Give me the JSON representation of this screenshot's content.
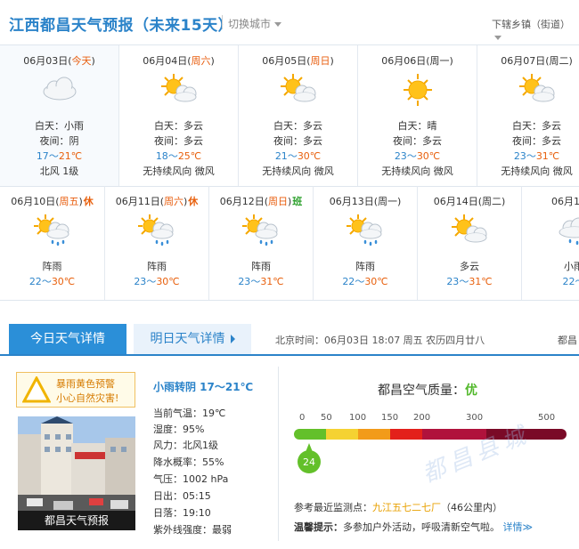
{
  "header": {
    "title": "江西都昌天气预报（未来15天）",
    "switch_city": "切换城市",
    "sub_area": "下辖乡镇（街道）"
  },
  "row1": [
    {
      "date": "06月03日",
      "weekday": "今天",
      "weekday_colored": true,
      "icon": "cloud-rain-icon",
      "day": "白天：小雨",
      "night": "夜间：阴",
      "lo": "17",
      "hi": "21℃",
      "wind": "北风 1级"
    },
    {
      "date": "06月04日",
      "weekday": "周六",
      "weekday_colored": true,
      "icon": "sun-cloud-icon",
      "day": "白天：多云",
      "night": "夜间：多云",
      "lo": "18",
      "hi": "25℃",
      "wind": "无持续风向 微风"
    },
    {
      "date": "06月05日",
      "weekday": "周日",
      "weekday_colored": true,
      "icon": "sun-cloud-icon",
      "day": "白天：多云",
      "night": "夜间：多云",
      "lo": "21",
      "hi": "30℃",
      "wind": "无持续风向 微风"
    },
    {
      "date": "06月06日",
      "weekday": "周一",
      "weekday_colored": false,
      "icon": "sun-icon",
      "day": "白天：晴",
      "night": "夜间：多云",
      "lo": "23",
      "hi": "30℃",
      "wind": "无持续风向 微风"
    },
    {
      "date": "06月07日",
      "weekday": "周二",
      "weekday_colored": false,
      "icon": "sun-cloud-icon",
      "day": "白天：多云",
      "night": "夜间：多云",
      "lo": "23",
      "hi": "31℃",
      "wind": "无持续风向 微风"
    }
  ],
  "row2": [
    {
      "date": "06月10日",
      "weekday": "周五",
      "weekday_colored": true,
      "tag": "休",
      "tag_type": "xiu",
      "icon": "sun-rain-icon",
      "desc": "阵雨",
      "lo": "22",
      "hi": "30℃"
    },
    {
      "date": "06月11日",
      "weekday": "周六",
      "weekday_colored": true,
      "tag": "休",
      "tag_type": "xiu",
      "icon": "sun-rain-icon",
      "desc": "阵雨",
      "lo": "23",
      "hi": "30℃"
    },
    {
      "date": "06月12日",
      "weekday": "周日",
      "weekday_colored": true,
      "tag": "班",
      "tag_type": "ban",
      "icon": "sun-rain-icon",
      "desc": "阵雨",
      "lo": "23",
      "hi": "31℃"
    },
    {
      "date": "06月13日",
      "weekday": "周一",
      "weekday_colored": false,
      "tag": "",
      "tag_type": "",
      "icon": "sun-rain-icon",
      "desc": "阵雨",
      "lo": "22",
      "hi": "30℃"
    },
    {
      "date": "06月14日",
      "weekday": "周二",
      "weekday_colored": false,
      "tag": "",
      "tag_type": "",
      "icon": "sun-cloud-icon",
      "desc": "多云",
      "lo": "23",
      "hi": "31℃"
    },
    {
      "date": "06月15日",
      "weekday": "",
      "weekday_colored": false,
      "tag": "",
      "tag_type": "",
      "icon": "cloud-rain-icon",
      "desc": "小雨",
      "lo": "22",
      "hi": ""
    }
  ],
  "tabs": {
    "today": "今日天气详情",
    "tomorrow": "明日天气详情",
    "beijing_time": "北京时间：06月03日  18:07  周五    农历四月廿八",
    "more_city": "都昌"
  },
  "warning": {
    "line1": "暴雨黄色预警",
    "line2": "小心自然灾害!"
  },
  "photo_caption": "都昌天气预报",
  "details": {
    "title": "小雨转阴  17～21℃",
    "lines": [
      "当前气温：19℃",
      "湿度：95%",
      "风力：北风1级",
      "降水概率：55%",
      "气压：1002 hPa",
      "日出：05:15",
      "日落：19:10",
      "紫外线强度：最弱"
    ]
  },
  "air": {
    "title": "都昌空气质量：",
    "level": "优",
    "ticks": [
      "0",
      "50",
      "100",
      "150",
      "200",
      "300",
      "500"
    ],
    "value": "24",
    "value_num": 24,
    "ref_label": "参考最近监测点：",
    "ref_station": "九江五七二七厂",
    "ref_dist": "（46公里内）",
    "tip_label": "温馨提示：",
    "tip_text": "多参加户外活动，呼吸清新空气啦。",
    "tip_more": "详情≫",
    "colors": [
      "#63c02a",
      "#f5d232",
      "#f29b1a",
      "#e3201b",
      "#b0123c",
      "#7a0a27"
    ]
  }
}
